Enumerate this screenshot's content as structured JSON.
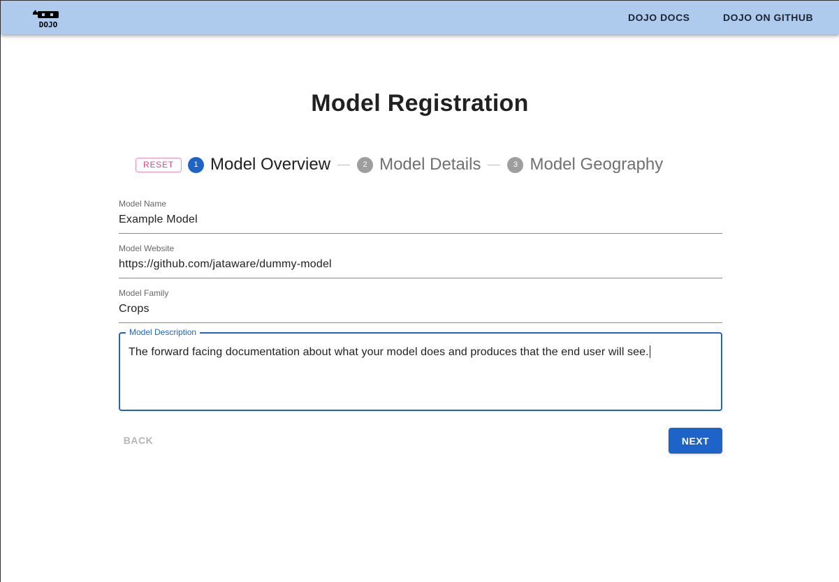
{
  "appbar": {
    "logo_text": "DOJO",
    "links": [
      {
        "label": "DOJO DOCS"
      },
      {
        "label": "DOJO ON GITHUB"
      }
    ],
    "background": "#aecbee"
  },
  "page": {
    "title": "Model Registration"
  },
  "stepper": {
    "reset_label": "RESET",
    "steps": [
      {
        "number": "1",
        "label": "Model Overview",
        "state": "active"
      },
      {
        "number": "2",
        "label": "Model Details",
        "state": "inactive"
      },
      {
        "number": "3",
        "label": "Model Geography",
        "state": "inactive"
      }
    ]
  },
  "form": {
    "model_name": {
      "label": "Model Name",
      "value": "Example Model"
    },
    "model_website": {
      "label": "Model Website",
      "value": "https://github.com/jataware/dummy-model"
    },
    "model_family": {
      "label": "Model Family",
      "value": "Crops"
    },
    "model_description": {
      "label": "Model Description",
      "value": "The forward facing documentation about what your model does and produces that the end user will see."
    }
  },
  "actions": {
    "back_label": "BACK",
    "next_label": "NEXT",
    "back_disabled": true
  },
  "colors": {
    "primary": "#1e64c8",
    "reset_accent": "#ec407a",
    "inactive_step": "#9e9e9e"
  }
}
